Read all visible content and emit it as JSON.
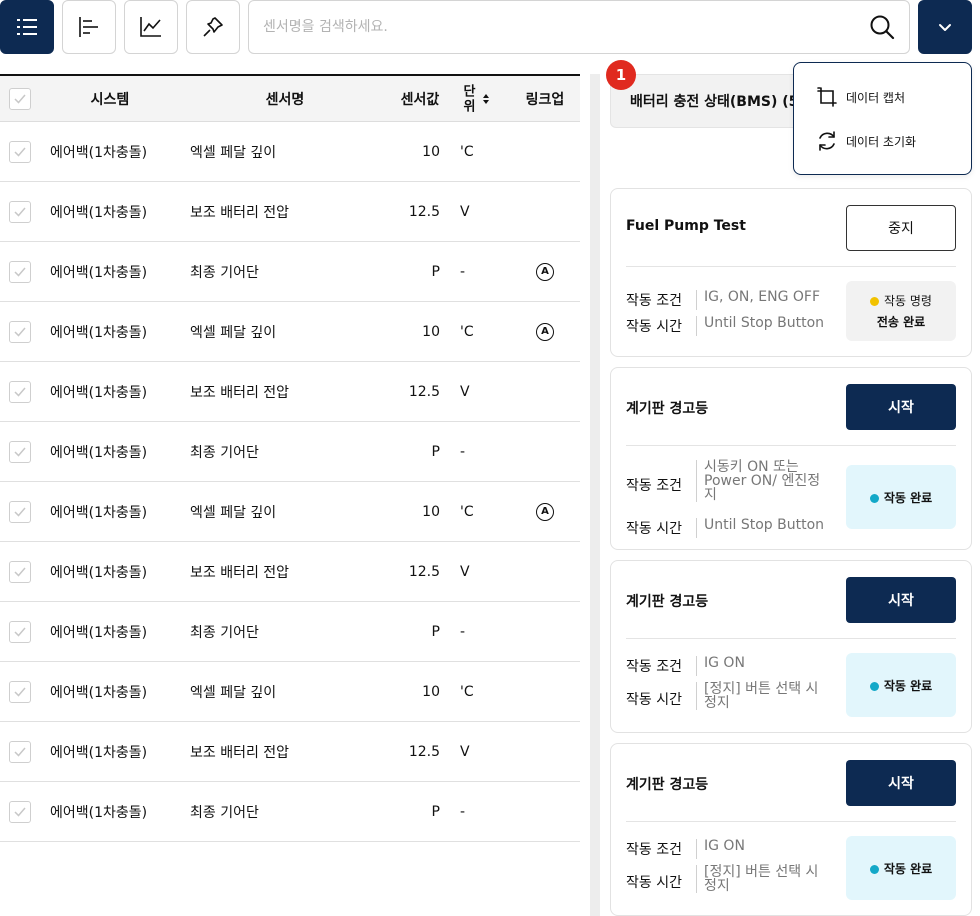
{
  "search": {
    "placeholder": "센서명을 검색하세요.",
    "value": ""
  },
  "table": {
    "headers": {
      "system": "시스템",
      "sensor": "센서명",
      "value": "센서값",
      "unit": "단위",
      "link": "링크업"
    },
    "rows": [
      {
        "system": "에어백(1차충돌)",
        "sensor": "엑셀 페달 깊이",
        "value": "10",
        "unit": "'C",
        "link": ""
      },
      {
        "system": "에어백(1차충돌)",
        "sensor": "보조 배터리 전압",
        "value": "12.5",
        "unit": "V",
        "link": ""
      },
      {
        "system": "에어백(1차충돌)",
        "sensor": "최종 기어단",
        "value": "P",
        "unit": "-",
        "link": "A"
      },
      {
        "system": "에어백(1차충돌)",
        "sensor": "엑셀 페달 깊이",
        "value": "10",
        "unit": "'C",
        "link": "A"
      },
      {
        "system": "에어백(1차충돌)",
        "sensor": "보조 배터리 전압",
        "value": "12.5",
        "unit": "V",
        "link": ""
      },
      {
        "system": "에어백(1차충돌)",
        "sensor": "최종 기어단",
        "value": "P",
        "unit": "-",
        "link": ""
      },
      {
        "system": "에어백(1차충돌)",
        "sensor": "엑셀 페달 깊이",
        "value": "10",
        "unit": "'C",
        "link": "A"
      },
      {
        "system": "에어백(1차충돌)",
        "sensor": "보조 배터리 전압",
        "value": "12.5",
        "unit": "V",
        "link": ""
      },
      {
        "system": "에어백(1차충돌)",
        "sensor": "최종 기어단",
        "value": "P",
        "unit": "-",
        "link": ""
      },
      {
        "system": "에어백(1차충돌)",
        "sensor": "엑셀 페달 깊이",
        "value": "10",
        "unit": "'C",
        "link": ""
      },
      {
        "system": "에어백(1차충돌)",
        "sensor": "보조 배터리 전압",
        "value": "12.5",
        "unit": "V",
        "link": ""
      },
      {
        "system": "에어백(1차충돌)",
        "sensor": "최종 기어단",
        "value": "P",
        "unit": "-",
        "link": ""
      }
    ]
  },
  "panel": {
    "badge": "1",
    "header_title": "배터리 충전 상태(BMS) (5)",
    "dropdown": {
      "capture": "데이터 캡처",
      "reset": "데이터 초기화"
    },
    "tests": [
      {
        "title": "Fuel Pump Test",
        "button": "중지",
        "cond_label": "작동 조건",
        "cond_value": "IG, ON, ENG OFF",
        "time_label": "작동 시간",
        "time_value": "Until Stop Button",
        "status_line1": "작동 명령",
        "status_line2": "전송 완료"
      },
      {
        "title": "계기판 경고등",
        "button": "시작",
        "cond_label": "작동 조건",
        "cond_value": "시동키 ON 또는 Power ON/ 엔진정지",
        "time_label": "작동 시간",
        "time_value": "Until Stop Button",
        "status_line1": "작동 완료"
      },
      {
        "title": "계기판 경고등",
        "button": "시작",
        "cond_label": "작동 조건",
        "cond_value": "IG ON",
        "time_label": "작동 시간",
        "time_value": "[정지] 버튼 선택 시 정지",
        "status_line1": "작동 완료"
      },
      {
        "title": "계기판 경고등",
        "button": "시작",
        "cond_label": "작동 조건",
        "cond_value": "IG ON",
        "time_label": "작동 시간",
        "time_value": "[정지] 버튼 선택 시 정지",
        "status_line1": "작동 완료"
      }
    ]
  },
  "colors": {
    "navy": "#0d2a52",
    "badge_red": "#e02a1f",
    "dot_yellow": "#f2c200",
    "dot_cyan": "#13a8c8"
  }
}
